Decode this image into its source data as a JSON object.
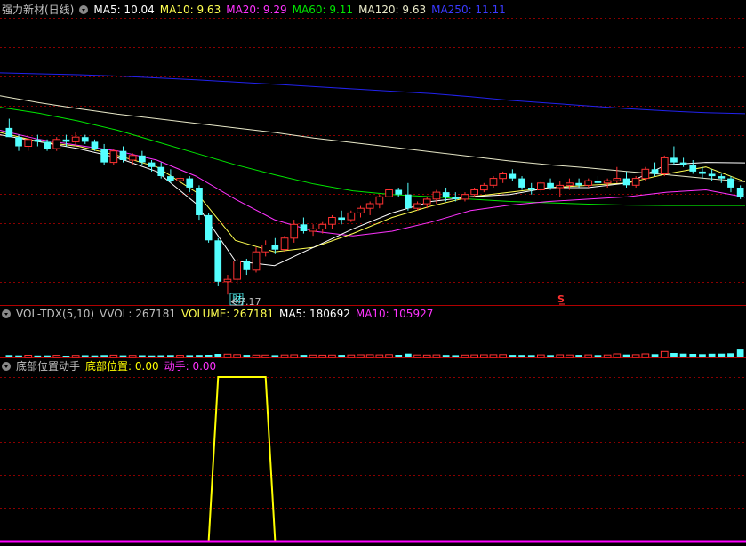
{
  "colors": {
    "bg": "#000000",
    "grid": "#8b0000",
    "up": "#ff3232",
    "down": "#54ffff",
    "ma5": "#ffffff",
    "ma10": "#ffff50",
    "ma20": "#ff33ff",
    "ma60": "#00e600",
    "ma120": "#e8e8c8",
    "ma250": "#2222ee",
    "bottom_line": "#ffff00",
    "move_line": "#ff00ff",
    "label": "#c0c0c0"
  },
  "main_legend": {
    "title": "强力新材(日线)",
    "ma5": "MA5: 10.04",
    "ma10": "MA10: 9.63",
    "ma20": "MA20: 9.29",
    "ma60": "MA60: 9.11",
    "ma120": "MA120: 9.63",
    "ma250": "MA250: 11.11"
  },
  "vol_legend": {
    "title": "VOL-TDX(5,10)",
    "vvol": "VVOL: 267181",
    "volume": "VOLUME: 267181",
    "ma5": "MA5: 180692",
    "ma10": "MA10: 105927"
  },
  "ind_legend": {
    "title": "底部位置动手",
    "bottom": "底部位置: 0.00",
    "move": "动手: 0.00"
  },
  "annotations": {
    "low_label": "7.17",
    "fin_marker": "财",
    "s_marker": "S"
  },
  "chart_data": [
    {
      "type": "candlestick",
      "y_range": [
        7.0,
        13.2
      ],
      "candles": [
        [
          10.8,
          11.0,
          10.6,
          10.6
        ],
        [
          10.6,
          10.65,
          10.3,
          10.4
        ],
        [
          10.4,
          10.6,
          10.3,
          10.55
        ],
        [
          10.55,
          10.65,
          10.4,
          10.5
        ],
        [
          10.5,
          10.55,
          10.3,
          10.35
        ],
        [
          10.35,
          10.6,
          10.3,
          10.55
        ],
        [
          10.55,
          10.65,
          10.4,
          10.5
        ],
        [
          10.5,
          10.7,
          10.4,
          10.6
        ],
        [
          10.6,
          10.65,
          10.45,
          10.5
        ],
        [
          10.5,
          10.55,
          10.3,
          10.35
        ],
        [
          10.35,
          10.45,
          10.0,
          10.05
        ],
        [
          10.05,
          10.35,
          10.0,
          10.3
        ],
        [
          10.3,
          10.4,
          10.05,
          10.1
        ],
        [
          10.1,
          10.25,
          10.0,
          10.2
        ],
        [
          10.2,
          10.3,
          10.0,
          10.05
        ],
        [
          10.05,
          10.1,
          9.85,
          9.95
        ],
        [
          9.95,
          10.05,
          9.7,
          9.75
        ],
        [
          9.75,
          9.9,
          9.6,
          9.65
        ],
        [
          9.65,
          9.8,
          9.55,
          9.7
        ],
        [
          9.7,
          9.75,
          9.4,
          9.5
        ],
        [
          9.5,
          9.55,
          8.8,
          8.9
        ],
        [
          8.9,
          8.95,
          8.3,
          8.35
        ],
        [
          8.35,
          8.4,
          7.35,
          7.45
        ],
        [
          7.45,
          7.6,
          7.17,
          7.5
        ],
        [
          7.5,
          7.95,
          7.4,
          7.9
        ],
        [
          7.9,
          7.95,
          7.6,
          7.7
        ],
        [
          7.7,
          8.2,
          7.65,
          8.1
        ],
        [
          8.1,
          8.35,
          8.0,
          8.25
        ],
        [
          8.25,
          8.4,
          8.05,
          8.15
        ],
        [
          8.15,
          8.45,
          8.1,
          8.4
        ],
        [
          8.4,
          8.8,
          8.3,
          8.7
        ],
        [
          8.7,
          8.85,
          8.5,
          8.55
        ],
        [
          8.55,
          8.7,
          8.45,
          8.6
        ],
        [
          8.6,
          8.75,
          8.5,
          8.7
        ],
        [
          8.7,
          8.9,
          8.6,
          8.85
        ],
        [
          8.85,
          9.0,
          8.7,
          8.8
        ],
        [
          8.8,
          9.0,
          8.75,
          8.95
        ],
        [
          8.95,
          9.1,
          8.85,
          9.05
        ],
        [
          9.05,
          9.2,
          8.9,
          9.15
        ],
        [
          9.15,
          9.35,
          9.05,
          9.3
        ],
        [
          9.3,
          9.5,
          9.2,
          9.45
        ],
        [
          9.45,
          9.5,
          9.3,
          9.35
        ],
        [
          9.35,
          9.6,
          9.0,
          9.05
        ],
        [
          9.05,
          9.2,
          9.0,
          9.15
        ],
        [
          9.15,
          9.3,
          9.05,
          9.25
        ],
        [
          9.25,
          9.45,
          9.15,
          9.4
        ],
        [
          9.4,
          9.5,
          9.2,
          9.3
        ],
        [
          9.3,
          9.4,
          9.2,
          9.25
        ],
        [
          9.25,
          9.4,
          9.2,
          9.35
        ],
        [
          9.35,
          9.5,
          9.3,
          9.45
        ],
        [
          9.45,
          9.6,
          9.4,
          9.55
        ],
        [
          9.55,
          9.75,
          9.5,
          9.7
        ],
        [
          9.7,
          9.85,
          9.6,
          9.8
        ],
        [
          9.8,
          9.9,
          9.65,
          9.7
        ],
        [
          9.7,
          9.75,
          9.45,
          9.5
        ],
        [
          9.5,
          9.6,
          9.35,
          9.45
        ],
        [
          9.45,
          9.65,
          9.4,
          9.6
        ],
        [
          9.6,
          9.7,
          9.45,
          9.5
        ],
        [
          9.5,
          9.65,
          9.3,
          9.55
        ],
        [
          9.55,
          9.7,
          9.45,
          9.6
        ],
        [
          9.6,
          9.7,
          9.5,
          9.55
        ],
        [
          9.55,
          9.7,
          9.5,
          9.65
        ],
        [
          9.65,
          9.75,
          9.5,
          9.6
        ],
        [
          9.6,
          9.7,
          9.5,
          9.65
        ],
        [
          9.65,
          9.95,
          9.6,
          9.7
        ],
        [
          9.7,
          9.85,
          9.5,
          9.55
        ],
        [
          9.55,
          9.75,
          9.5,
          9.7
        ],
        [
          9.7,
          9.95,
          9.65,
          9.9
        ],
        [
          9.9,
          10.05,
          9.75,
          9.8
        ],
        [
          9.8,
          10.2,
          9.75,
          10.15
        ],
        [
          10.15,
          10.4,
          10.0,
          10.05
        ],
        [
          10.05,
          10.15,
          9.95,
          10.0
        ],
        [
          10.0,
          10.1,
          9.8,
          9.85
        ],
        [
          9.85,
          9.95,
          9.7,
          9.8
        ],
        [
          9.8,
          9.9,
          9.65,
          9.75
        ],
        [
          9.75,
          9.8,
          9.6,
          9.7
        ],
        [
          9.7,
          9.75,
          9.4,
          9.5
        ],
        [
          9.5,
          9.55,
          9.25,
          9.3
        ]
      ],
      "low_marker": {
        "index": 23,
        "value": 7.17
      },
      "ma_series": [
        {
          "key": "ma250",
          "values": [
            12.0,
            11.98,
            11.96,
            11.93,
            11.89,
            11.85,
            11.8,
            11.75,
            11.7,
            11.65,
            11.6,
            11.55,
            11.48,
            11.4,
            11.34,
            11.28,
            11.22,
            11.17,
            11.13,
            11.11
          ]
        },
        {
          "key": "ma120",
          "values": [
            11.5,
            11.35,
            11.22,
            11.1,
            11.0,
            10.9,
            10.8,
            10.7,
            10.58,
            10.48,
            10.38,
            10.28,
            10.18,
            10.08,
            10.0,
            9.93,
            9.85,
            9.78,
            9.7,
            9.63
          ]
        },
        {
          "key": "ma60",
          "values": [
            11.25,
            11.12,
            10.95,
            10.75,
            10.5,
            10.25,
            10.0,
            9.78,
            9.58,
            9.43,
            9.35,
            9.3,
            9.25,
            9.2,
            9.17,
            9.14,
            9.12,
            9.11,
            9.11,
            9.11
          ]
        },
        {
          "key": "ma20",
          "values": [
            10.75,
            10.55,
            10.42,
            10.3,
            10.1,
            9.75,
            9.25,
            8.8,
            8.55,
            8.45,
            8.55,
            8.75,
            9.0,
            9.12,
            9.2,
            9.25,
            9.3,
            9.4,
            9.45,
            9.29
          ]
        },
        {
          "key": "ma10",
          "values": [
            10.7,
            10.5,
            10.4,
            10.2,
            9.95,
            9.4,
            8.35,
            8.1,
            8.2,
            8.5,
            8.85,
            9.1,
            9.3,
            9.4,
            9.5,
            9.55,
            9.6,
            9.8,
            9.95,
            9.63
          ]
        },
        {
          "key": "ma5",
          "values": [
            10.65,
            10.5,
            10.35,
            10.15,
            9.85,
            9.15,
            7.9,
            7.8,
            8.2,
            8.6,
            8.95,
            9.2,
            9.3,
            9.35,
            9.5,
            9.5,
            9.6,
            10.0,
            10.05,
            10.04
          ]
        }
      ]
    },
    {
      "type": "bar",
      "y_range": [
        0,
        1200000
      ],
      "values": [
        80000,
        70000,
        75000,
        65000,
        70000,
        72000,
        60000,
        68000,
        75000,
        70000,
        82000,
        78000,
        72000,
        70000,
        74000,
        68000,
        76000,
        80000,
        72000,
        78000,
        85000,
        90000,
        120000,
        110000,
        95000,
        88000,
        80000,
        82000,
        78000,
        84000,
        90000,
        86000,
        80000,
        78000,
        82000,
        88000,
        85000,
        90000,
        92000,
        88000,
        95000,
        90000,
        130000,
        85000,
        80000,
        88000,
        84000,
        78000,
        82000,
        86000,
        90000,
        92000,
        95000,
        88000,
        84000,
        80000,
        86000,
        82000,
        90000,
        84000,
        88000,
        86000,
        82000,
        85000,
        120000,
        98000,
        94000,
        120000,
        110000,
        200000,
        150000,
        130000,
        120000,
        110000,
        125000,
        130000,
        140000,
        267181
      ]
    },
    {
      "type": "line",
      "y_range": [
        0,
        1
      ],
      "series": [
        {
          "key": "bottom_line",
          "x": [
            0,
            21,
            22,
            27,
            28,
            77
          ],
          "values": [
            0,
            0,
            1,
            1,
            0,
            0
          ]
        },
        {
          "key": "move_line",
          "x": [
            0,
            77
          ],
          "values": [
            0,
            0
          ]
        }
      ]
    }
  ]
}
